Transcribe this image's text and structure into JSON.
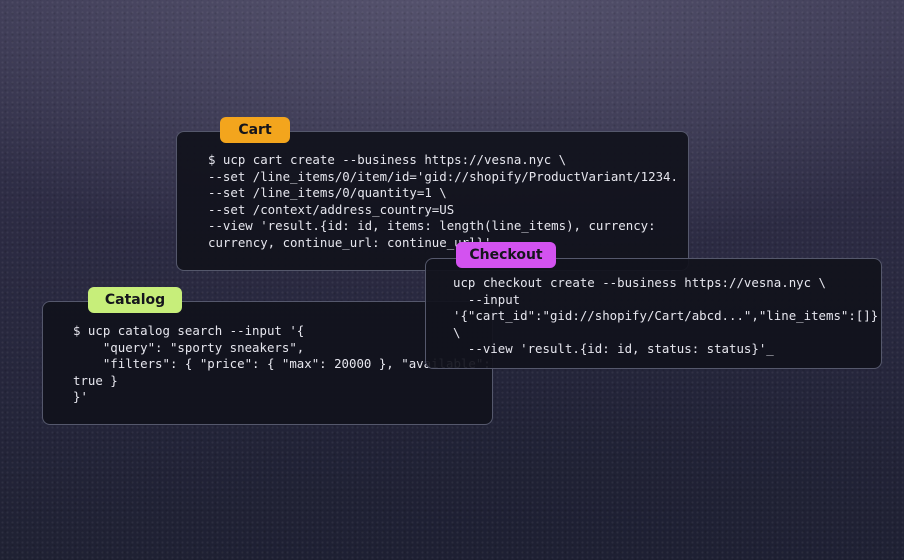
{
  "catalog": {
    "tag_label": "Catalog",
    "code_lines": [
      "$ ucp catalog search --input '{",
      "    \"query\": \"sporty sneakers\",",
      "    \"filters\": { \"price\": { \"max\": 20000 }, \"available\":",
      "true }",
      "}'"
    ]
  },
  "cart": {
    "tag_label": "Cart",
    "code_lines": [
      "$ ucp cart create --business https://vesna.nyc \\",
      "--set /line_items/0/item/id='gid://shopify/ProductVariant/1234.",
      "--set /line_items/0/quantity=1 \\",
      "--set /context/address_country=US",
      "--view 'result.{id: id, items: length(line_items), currency:",
      "currency, continue_url: continue_url}'"
    ]
  },
  "checkout": {
    "tag_label": "Checkout",
    "code_lines": [
      "ucp checkout create --business https://vesna.nyc \\",
      "  --input",
      "'{\"cart_id\":\"gid://shopify/Cart/abcd...\",\"line_items\":[]}'",
      "\\",
      "  --view 'result.{id: id, status: status}'_"
    ]
  }
}
